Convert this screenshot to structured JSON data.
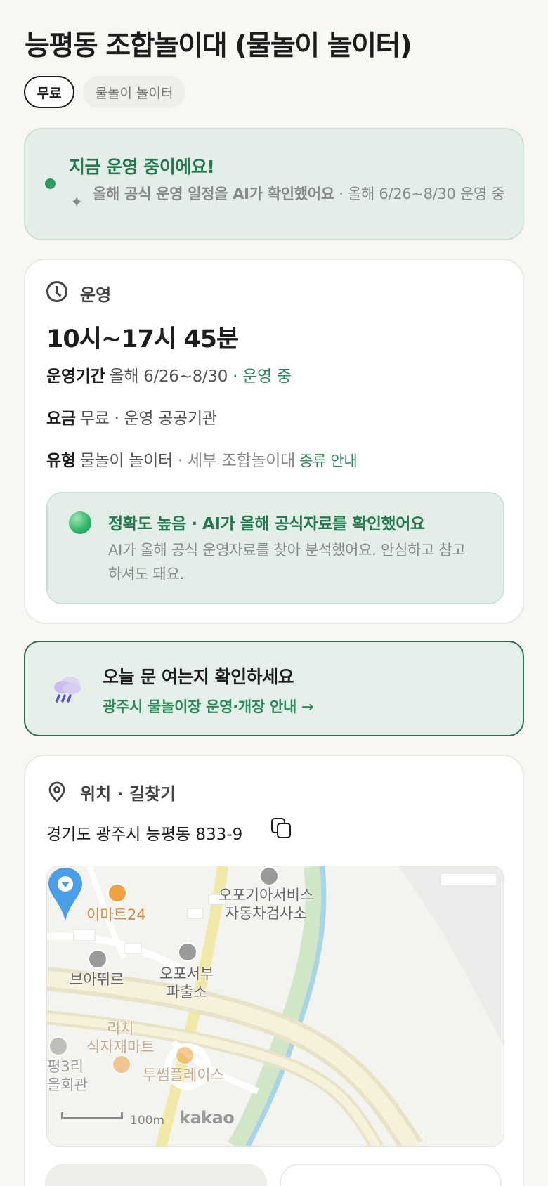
{
  "place": {
    "title": "능평동 조합놀이대 (물놀이 놀이터)",
    "chips": [
      "무료",
      "물놀이 놀이터"
    ]
  },
  "status": {
    "title": "지금 운영 중이에요!",
    "sub_bold": "올해 공식 운영 일정을 AI가 확인했어요",
    "sub_rest": " · 올해 6/26~8/30 운영 중",
    "colors": {
      "accent": "#2e9a62",
      "bg": "#e3eee8"
    }
  },
  "operation": {
    "label": "운영",
    "hours": "10시~17시 45분",
    "period_key": "운영기간",
    "period_value": "올해 6/26~8/30",
    "period_status": "· 운영 중",
    "fee_key": "요금",
    "fee_value": "무료 · 운영 공공기관",
    "type_key": "유형",
    "type_value": "물놀이 놀이터",
    "type_detail": "· 세부 조합놀이대",
    "type_link": "종류 안내",
    "accuracy_title": "정확도 높음 · AI가 올해 공식자료를 확인했어요",
    "accuracy_desc": "AI가 올해 공식 운영자료를 찾아 분석했어요. 안심하고 참고하셔도 돼요."
  },
  "notice": {
    "title": "오늘 문 여는지 확인하세요",
    "link": "광주시 물놀이장 운영·개장 안내 →",
    "icon": "rain-cloud-icon"
  },
  "location": {
    "label": "위치 · 길찾기",
    "address": "경기도 광주시 능평동 833-9",
    "map_labels": {
      "emart": "이마트24",
      "kia": "오포기아서비스\n자동차검사소",
      "bread": "브아뛰르",
      "police": "오포서부\n파출소",
      "rich": "리치\n식자재마트",
      "twosome": "투썸플레이스",
      "hall": "평3리\n을회관"
    },
    "scale": "100m",
    "brand": "kakao"
  }
}
